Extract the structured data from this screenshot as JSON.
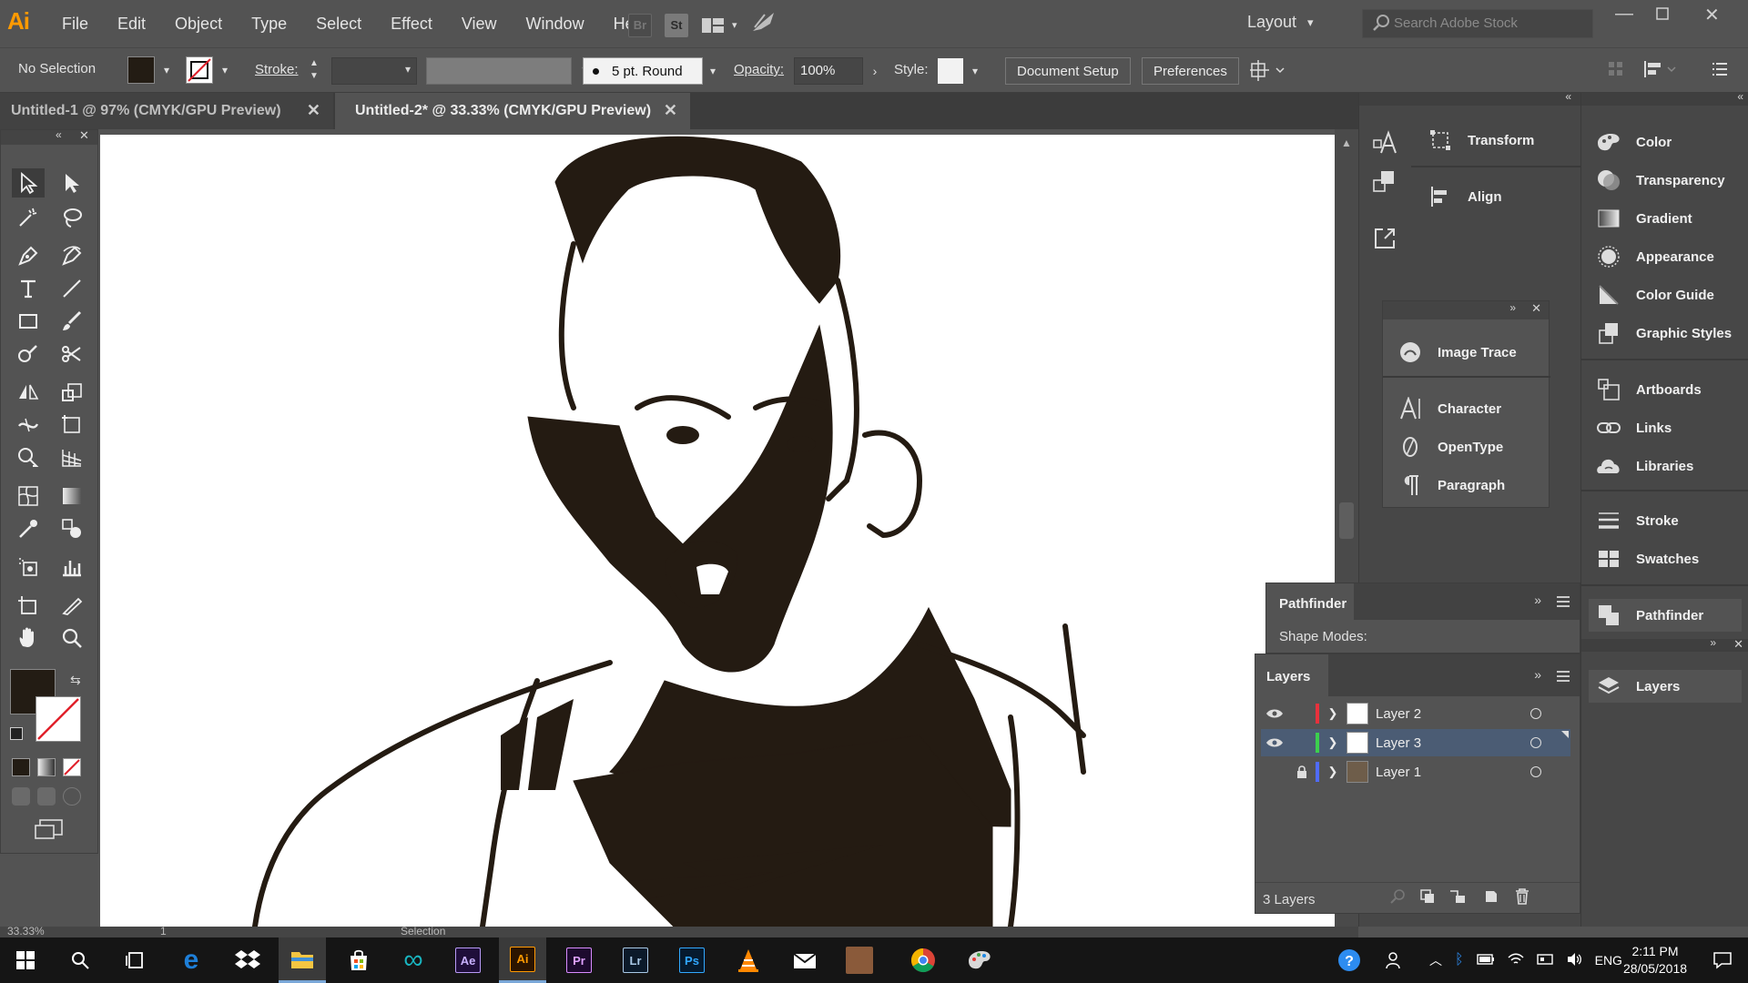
{
  "app": {
    "logo": "Ai",
    "menu": [
      "File",
      "Edit",
      "Object",
      "Type",
      "Select",
      "Effect",
      "View",
      "Window",
      "Help"
    ],
    "bridge_label": "Br",
    "stock_label": "St",
    "workspace": "Layout",
    "search_placeholder": "Search Adobe Stock"
  },
  "control_bar": {
    "selection": "No Selection",
    "stroke_label": "Stroke:",
    "brush": "5 pt. Round",
    "opacity_label": "Opacity:",
    "opacity_value": "100%",
    "style_label": "Style:",
    "document_setup": "Document Setup",
    "preferences": "Preferences",
    "fill_color": "#231c14",
    "stroke_color": "#ffffff"
  },
  "tabs": [
    {
      "label": "Untitled-1 @ 97% (CMYK/GPU Preview)",
      "active": false
    },
    {
      "label": "Untitled-2* @ 33.33% (CMYK/GPU Preview)",
      "active": true
    }
  ],
  "status": {
    "zoom": "33.33%",
    "page": "1",
    "tool": "Selection"
  },
  "panels": {
    "dock2_top": [
      "Transform",
      "Align"
    ],
    "floating": [
      "Image Trace",
      "Character",
      "OpenType",
      "Paragraph"
    ],
    "dock3_group1": [
      "Color",
      "Transparency",
      "Gradient",
      "Appearance",
      "Color Guide",
      "Graphic Styles"
    ],
    "dock3_group2": [
      "Artboards",
      "Links",
      "Libraries"
    ],
    "dock3_group3": [
      "Stroke",
      "Swatches"
    ],
    "dock3_pathfinder": "Pathfinder",
    "dock3_layers": "Layers"
  },
  "pathfinder": {
    "title": "Pathfinder",
    "shape_modes": "Shape Modes:"
  },
  "layers_panel": {
    "title": "Layers",
    "count": "3 Layers",
    "layers": [
      {
        "name": "Layer 2",
        "color": "#e8313c",
        "visible": true,
        "locked": false,
        "selected": false
      },
      {
        "name": "Layer 3",
        "color": "#3ccf4e",
        "visible": true,
        "locked": false,
        "selected": true
      },
      {
        "name": "Layer 1",
        "color": "#4f6bff",
        "visible": false,
        "locked": true,
        "selected": false
      }
    ]
  },
  "taskbar": {
    "apps": [
      "start",
      "search",
      "task-view",
      "edge",
      "dropbox",
      "file-explorer",
      "store",
      "arduino",
      "after-effects",
      "illustrator",
      "premiere",
      "lightroom",
      "photoshop",
      "vlc",
      "mail",
      "photo",
      "chrome",
      "paint"
    ],
    "ae": "Ae",
    "ai": "Ai",
    "pr": "Pr",
    "lr": "Lr",
    "ps": "Ps",
    "lang": "ENG",
    "time": "2:11 PM",
    "date": "28/05/2018"
  }
}
